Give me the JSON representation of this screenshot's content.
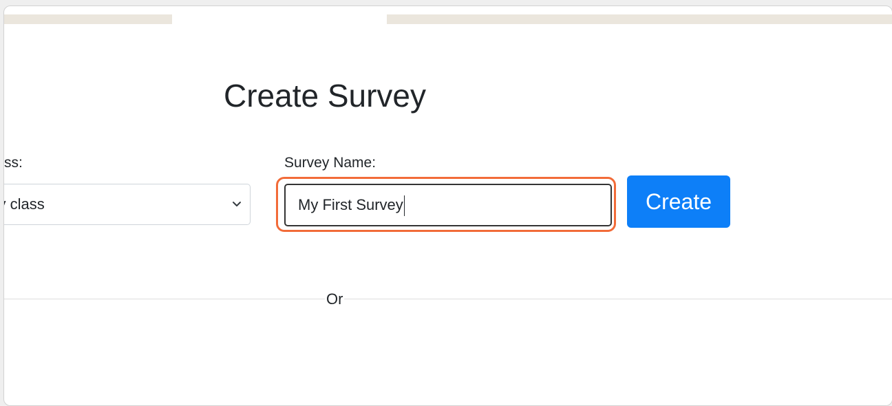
{
  "page": {
    "title": "Create Survey",
    "divider_text": "Or"
  },
  "class_field": {
    "label": "ss:",
    "selected_value": "f my class"
  },
  "survey_field": {
    "label": "Survey Name:",
    "value": "My First Survey"
  },
  "actions": {
    "create_label": "Create"
  },
  "colors": {
    "primary_button": "#0d7ff8",
    "focus_highlight": "#f26b38",
    "top_bar": "#ebe6dd"
  },
  "icons": {
    "select_arrow": "chevron-down-icon"
  }
}
